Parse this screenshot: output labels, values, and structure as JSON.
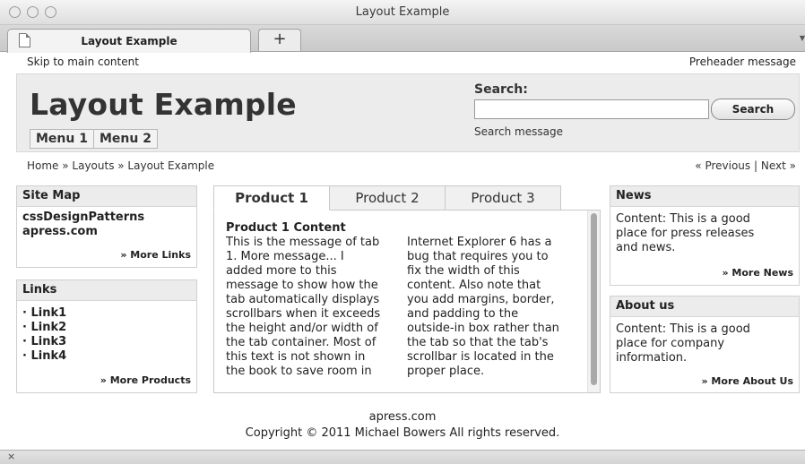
{
  "window": {
    "title": "Layout Example"
  },
  "browser_tabs": [
    {
      "label": "Layout Example"
    }
  ],
  "new_tab_label": "+",
  "preheader": {
    "skip_link": "Skip to main content",
    "message": "Preheader message"
  },
  "header": {
    "title": "Layout Example",
    "menu": [
      "Menu 1",
      "Menu 2"
    ],
    "search": {
      "label": "Search:",
      "value": "",
      "button": "Search",
      "message": "Search message"
    }
  },
  "breadcrumb": {
    "text": "Home » Layouts » Layout Example",
    "previous": "« Previous",
    "separator": "|",
    "next": "Next »"
  },
  "sitemap": {
    "title": "Site Map",
    "lines": [
      "cssDesignPatterns",
      "apress.com"
    ],
    "more": "» More Links"
  },
  "links": {
    "title": "Links",
    "items": [
      "· Link1",
      "· Link2",
      "· Link3",
      "· Link4"
    ],
    "more": "» More Products"
  },
  "product_tabs": [
    "Product 1",
    "Product 2",
    "Product 3"
  ],
  "product_content": {
    "heading": "Product 1 Content",
    "col1": [
      "This is the message of tab",
      "1. More message... I",
      "added more to this",
      "message to show how the",
      "tab automatically displays",
      "scrollbars when it exceeds",
      "the height and/or width of",
      "the tab container. Most of",
      "this text is not shown in",
      "the book to save room in"
    ],
    "col2": [
      "Internet Explorer 6 has a",
      "bug that requires you to",
      "fix the width of this",
      "content. Also note that",
      "you add margins, border,",
      "and padding to the",
      "outside-in box rather than",
      "the tab so that the tab's",
      "scrollbar is located in the",
      "proper place."
    ]
  },
  "news": {
    "title": "News",
    "lines": [
      "Content: This is a good",
      "place for press releases",
      "and news."
    ],
    "more": "» More News"
  },
  "about": {
    "title": "About us",
    "lines": [
      "Content: This is a good",
      "place for company",
      "information."
    ],
    "more": "» More About Us"
  },
  "footer": {
    "line1": "apress.com",
    "line2": "Copyright © 2011 Michael Bowers All rights reserved."
  },
  "statusbar": {
    "close_label": "×"
  }
}
